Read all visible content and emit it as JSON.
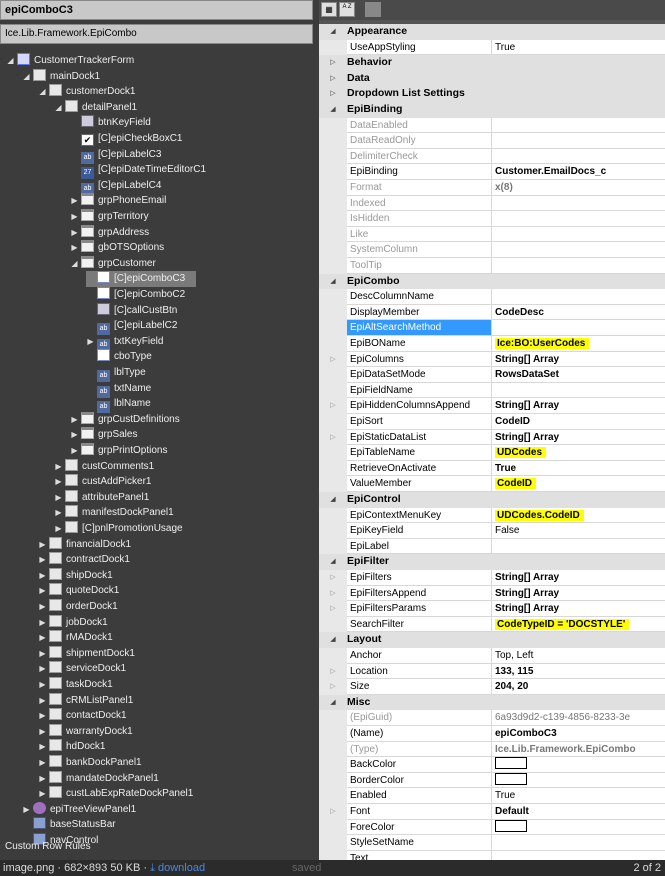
{
  "left": {
    "title": "epiComboC3",
    "type": "Ice.Lib.Framework.EpiCombo",
    "tree": [
      {
        "label": "CustomerTrackerForm",
        "depth": 0,
        "toggle": "open",
        "icon": "form"
      },
      {
        "label": "mainDock1",
        "depth": 1,
        "toggle": "open",
        "icon": "dock"
      },
      {
        "label": "customerDock1",
        "depth": 2,
        "toggle": "open",
        "icon": "dock"
      },
      {
        "label": "detailPanel1",
        "depth": 3,
        "toggle": "open",
        "icon": "dock"
      },
      {
        "label": "btnKeyField",
        "depth": 4,
        "toggle": "",
        "icon": "btn"
      },
      {
        "label": "[C]epiCheckBoxC1",
        "depth": 4,
        "toggle": "",
        "icon": "chk"
      },
      {
        "label": "[C]epiLabelC3",
        "depth": 4,
        "toggle": "",
        "icon": "lbl"
      },
      {
        "label": "[C]epiDateTimeEditorC1",
        "depth": 4,
        "toggle": "",
        "icon": "dt"
      },
      {
        "label": "[C]epiLabelC4",
        "depth": 4,
        "toggle": "",
        "icon": "lbl"
      },
      {
        "label": "grpPhoneEmail",
        "depth": 4,
        "toggle": "closed",
        "icon": "grp"
      },
      {
        "label": "grpTerritory",
        "depth": 4,
        "toggle": "closed",
        "icon": "grp"
      },
      {
        "label": "grpAddress",
        "depth": 4,
        "toggle": "closed",
        "icon": "grp"
      },
      {
        "label": "gbOTSOptions",
        "depth": 4,
        "toggle": "closed",
        "icon": "grp"
      },
      {
        "label": "grpCustomer",
        "depth": 4,
        "toggle": "open",
        "icon": "grp"
      },
      {
        "label": "[C]epiComboC3",
        "depth": 5,
        "toggle": "",
        "icon": "cbo",
        "selected": true
      },
      {
        "label": "[C]epiComboC2",
        "depth": 5,
        "toggle": "",
        "icon": "cbo"
      },
      {
        "label": "[C]callCustBtn",
        "depth": 5,
        "toggle": "",
        "icon": "btn"
      },
      {
        "label": "[C]epiLabelC2",
        "depth": 5,
        "toggle": "",
        "icon": "lbl"
      },
      {
        "label": "txtKeyField",
        "depth": 5,
        "toggle": "closed",
        "icon": "lbl"
      },
      {
        "label": "cboType",
        "depth": 5,
        "toggle": "",
        "icon": "cbo"
      },
      {
        "label": "lblType",
        "depth": 5,
        "toggle": "",
        "icon": "lbl"
      },
      {
        "label": "txtName",
        "depth": 5,
        "toggle": "",
        "icon": "lbl"
      },
      {
        "label": "lblName",
        "depth": 5,
        "toggle": "",
        "icon": "lbl"
      },
      {
        "label": "grpCustDefinitions",
        "depth": 4,
        "toggle": "closed",
        "icon": "grp"
      },
      {
        "label": "grpSales",
        "depth": 4,
        "toggle": "closed",
        "icon": "grp"
      },
      {
        "label": "grpPrintOptions",
        "depth": 4,
        "toggle": "closed",
        "icon": "grp"
      },
      {
        "label": "custComments1",
        "depth": 3,
        "toggle": "closed",
        "icon": "dock"
      },
      {
        "label": "custAddPicker1",
        "depth": 3,
        "toggle": "closed",
        "icon": "dock"
      },
      {
        "label": "attributePanel1",
        "depth": 3,
        "toggle": "closed",
        "icon": "dock"
      },
      {
        "label": "manifestDockPanel1",
        "depth": 3,
        "toggle": "closed",
        "icon": "dock"
      },
      {
        "label": "[C]pnlPromotionUsage",
        "depth": 3,
        "toggle": "closed",
        "icon": "dock"
      },
      {
        "label": "financialDock1",
        "depth": 2,
        "toggle": "closed",
        "icon": "dock"
      },
      {
        "label": "contractDock1",
        "depth": 2,
        "toggle": "closed",
        "icon": "dock"
      },
      {
        "label": "shipDock1",
        "depth": 2,
        "toggle": "closed",
        "icon": "dock"
      },
      {
        "label": "quoteDock1",
        "depth": 2,
        "toggle": "closed",
        "icon": "dock"
      },
      {
        "label": "orderDock1",
        "depth": 2,
        "toggle": "closed",
        "icon": "dock"
      },
      {
        "label": "jobDock1",
        "depth": 2,
        "toggle": "closed",
        "icon": "dock"
      },
      {
        "label": "rMADock1",
        "depth": 2,
        "toggle": "closed",
        "icon": "dock"
      },
      {
        "label": "shipmentDock1",
        "depth": 2,
        "toggle": "closed",
        "icon": "dock"
      },
      {
        "label": "serviceDock1",
        "depth": 2,
        "toggle": "closed",
        "icon": "dock"
      },
      {
        "label": "taskDock1",
        "depth": 2,
        "toggle": "closed",
        "icon": "dock"
      },
      {
        "label": "cRMListPanel1",
        "depth": 2,
        "toggle": "closed",
        "icon": "dock"
      },
      {
        "label": "contactDock1",
        "depth": 2,
        "toggle": "closed",
        "icon": "dock"
      },
      {
        "label": "warrantyDock1",
        "depth": 2,
        "toggle": "closed",
        "icon": "dock"
      },
      {
        "label": "hdDock1",
        "depth": 2,
        "toggle": "closed",
        "icon": "dock"
      },
      {
        "label": "bankDockPanel1",
        "depth": 2,
        "toggle": "closed",
        "icon": "dock"
      },
      {
        "label": "mandateDockPanel1",
        "depth": 2,
        "toggle": "closed",
        "icon": "dock"
      },
      {
        "label": "custLabExpRateDockPanel1",
        "depth": 2,
        "toggle": "closed",
        "icon": "dock"
      },
      {
        "label": "epiTreeViewPanel1",
        "depth": 1,
        "toggle": "closed",
        "icon": "tree"
      },
      {
        "label": "baseStatusBar",
        "depth": 1,
        "toggle": "",
        "icon": "bar"
      },
      {
        "label": "navControl",
        "depth": 1,
        "toggle": "",
        "icon": "bar"
      }
    ],
    "custom_row_rules": "Custom Row Rules"
  },
  "toolbar": {
    "categorized_icon": "categorized-icon",
    "alphabetical_label": "A Z"
  },
  "grid": [
    {
      "kind": "cat",
      "name": "Appearance",
      "open": true
    },
    {
      "kind": "prop",
      "name": "UseAppStyling",
      "value": "True"
    },
    {
      "kind": "cat",
      "name": "Behavior",
      "open": false
    },
    {
      "kind": "cat",
      "name": "Data",
      "open": false
    },
    {
      "kind": "cat",
      "name": "Dropdown List Settings",
      "open": false
    },
    {
      "kind": "cat",
      "name": "EpiBinding",
      "open": true
    },
    {
      "kind": "prop",
      "name": "DataEnabled",
      "value": "",
      "dim": true
    },
    {
      "kind": "prop",
      "name": "DataReadOnly",
      "value": "",
      "dim": true
    },
    {
      "kind": "prop",
      "name": "DelimiterCheck",
      "value": "",
      "dim": true
    },
    {
      "kind": "prop",
      "name": "EpiBinding",
      "value": "Customer.EmailDocs_c",
      "bold": true
    },
    {
      "kind": "prop",
      "name": "Format",
      "value": "x(8)",
      "dim": true,
      "boldDim": true
    },
    {
      "kind": "prop",
      "name": "Indexed",
      "value": "",
      "dim": true
    },
    {
      "kind": "prop",
      "name": "IsHidden",
      "value": "",
      "dim": true
    },
    {
      "kind": "prop",
      "name": "Like",
      "value": "",
      "dim": true
    },
    {
      "kind": "prop",
      "name": "SystemColumn",
      "value": "",
      "dim": true
    },
    {
      "kind": "prop",
      "name": "ToolTip",
      "value": "",
      "dim": true
    },
    {
      "kind": "cat",
      "name": "EpiCombo",
      "open": true
    },
    {
      "kind": "prop",
      "name": "DescColumnName",
      "value": ""
    },
    {
      "kind": "prop",
      "name": "DisplayMember",
      "value": "CodeDesc",
      "bold": true
    },
    {
      "kind": "prop",
      "name": "EpiAltSearchMethod",
      "value": "",
      "highlight": true
    },
    {
      "kind": "prop",
      "name": "EpiBOName",
      "value": "Ice:BO:UserCodes",
      "bold": true,
      "yellow": true
    },
    {
      "kind": "prop",
      "name": "EpiColumns",
      "value": "String[] Array",
      "bold": true,
      "exp": true
    },
    {
      "kind": "prop",
      "name": "EpiDataSetMode",
      "value": "RowsDataSet",
      "bold": true
    },
    {
      "kind": "prop",
      "name": "EpiFieldName",
      "value": ""
    },
    {
      "kind": "prop",
      "name": "EpiHiddenColumnsAppend",
      "value": "String[] Array",
      "bold": true,
      "exp": true
    },
    {
      "kind": "prop",
      "name": "EpiSort",
      "value": "CodeID",
      "bold": true
    },
    {
      "kind": "prop",
      "name": "EpiStaticDataList",
      "value": "String[] Array",
      "bold": true,
      "exp": true
    },
    {
      "kind": "prop",
      "name": "EpiTableName",
      "value": "UDCodes",
      "bold": true,
      "yellow": true
    },
    {
      "kind": "prop",
      "name": "RetrieveOnActivate",
      "value": "True",
      "bold": true
    },
    {
      "kind": "prop",
      "name": "ValueMember",
      "value": "CodeID",
      "bold": true,
      "yellow": true
    },
    {
      "kind": "cat",
      "name": "EpiControl",
      "open": true
    },
    {
      "kind": "prop",
      "name": "EpiContextMenuKey",
      "value": "UDCodes.CodeID",
      "bold": true,
      "yellow": true
    },
    {
      "kind": "prop",
      "name": "EpiKeyField",
      "value": "False"
    },
    {
      "kind": "prop",
      "name": "EpiLabel",
      "value": ""
    },
    {
      "kind": "cat",
      "name": "EpiFilter",
      "open": true
    },
    {
      "kind": "prop",
      "name": "EpiFilters",
      "value": "String[] Array",
      "bold": true,
      "exp": true
    },
    {
      "kind": "prop",
      "name": "EpiFiltersAppend",
      "value": "String[] Array",
      "bold": true,
      "exp": true
    },
    {
      "kind": "prop",
      "name": "EpiFiltersParams",
      "value": "String[] Array",
      "bold": true,
      "exp": true
    },
    {
      "kind": "prop",
      "name": "SearchFilter",
      "value": "CodeTypeID = 'DOCSTYLE'",
      "bold": true,
      "yellow": true
    },
    {
      "kind": "cat",
      "name": "Layout",
      "open": true
    },
    {
      "kind": "prop",
      "name": "Anchor",
      "value": "Top, Left"
    },
    {
      "kind": "prop",
      "name": "Location",
      "value": "133, 115",
      "bold": true,
      "exp": true
    },
    {
      "kind": "prop",
      "name": "Size",
      "value": "204, 20",
      "bold": true,
      "exp": true
    },
    {
      "kind": "cat",
      "name": "Misc",
      "open": true
    },
    {
      "kind": "prop",
      "name": "(EpiGuid)",
      "value": "6a93d9d2-c139-4856-8233-3e",
      "dim": true,
      "valDim": true
    },
    {
      "kind": "prop",
      "name": "(Name)",
      "value": "epiComboC3",
      "bold": true
    },
    {
      "kind": "prop",
      "name": "(Type)",
      "value": "Ice.Lib.Framework.EpiCombo",
      "dim": true,
      "boldDim": true
    },
    {
      "kind": "prop",
      "name": "BackColor",
      "value": "",
      "swatch": true
    },
    {
      "kind": "prop",
      "name": "BorderColor",
      "value": "",
      "swatch": true
    },
    {
      "kind": "prop",
      "name": "Enabled",
      "value": "True"
    },
    {
      "kind": "prop",
      "name": "Font",
      "value": "Default",
      "bold": true,
      "exp": true
    },
    {
      "kind": "prop",
      "name": "ForeColor",
      "value": "",
      "swatch": true
    },
    {
      "kind": "prop",
      "name": "StyleSetName",
      "value": ""
    },
    {
      "kind": "prop",
      "name": "Text",
      "value": ""
    }
  ],
  "status": {
    "filename": "image.png · 682×893 50 KB · ",
    "download": "⤓ download",
    "saved": "saved",
    "page": "2 of 2"
  }
}
